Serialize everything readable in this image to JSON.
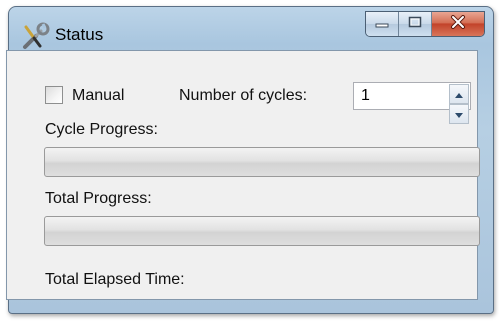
{
  "window": {
    "title": "Status"
  },
  "form": {
    "manual_label": "Manual",
    "manual_checked": false,
    "cycles_label": "Number of cycles:",
    "cycles_value": "1",
    "cycle_progress_label": "Cycle Progress:",
    "cycle_progress_value": 0,
    "total_progress_label": "Total Progress:",
    "total_progress_value": 0,
    "elapsed_label": "Total Elapsed Time:"
  },
  "icons": {
    "app": "wrench-screwdriver-icon",
    "minimize": "minimize-icon",
    "maximize": "maximize-icon",
    "close": "close-icon",
    "spin_up": "chevron-up-icon",
    "spin_down": "chevron-down-icon"
  }
}
